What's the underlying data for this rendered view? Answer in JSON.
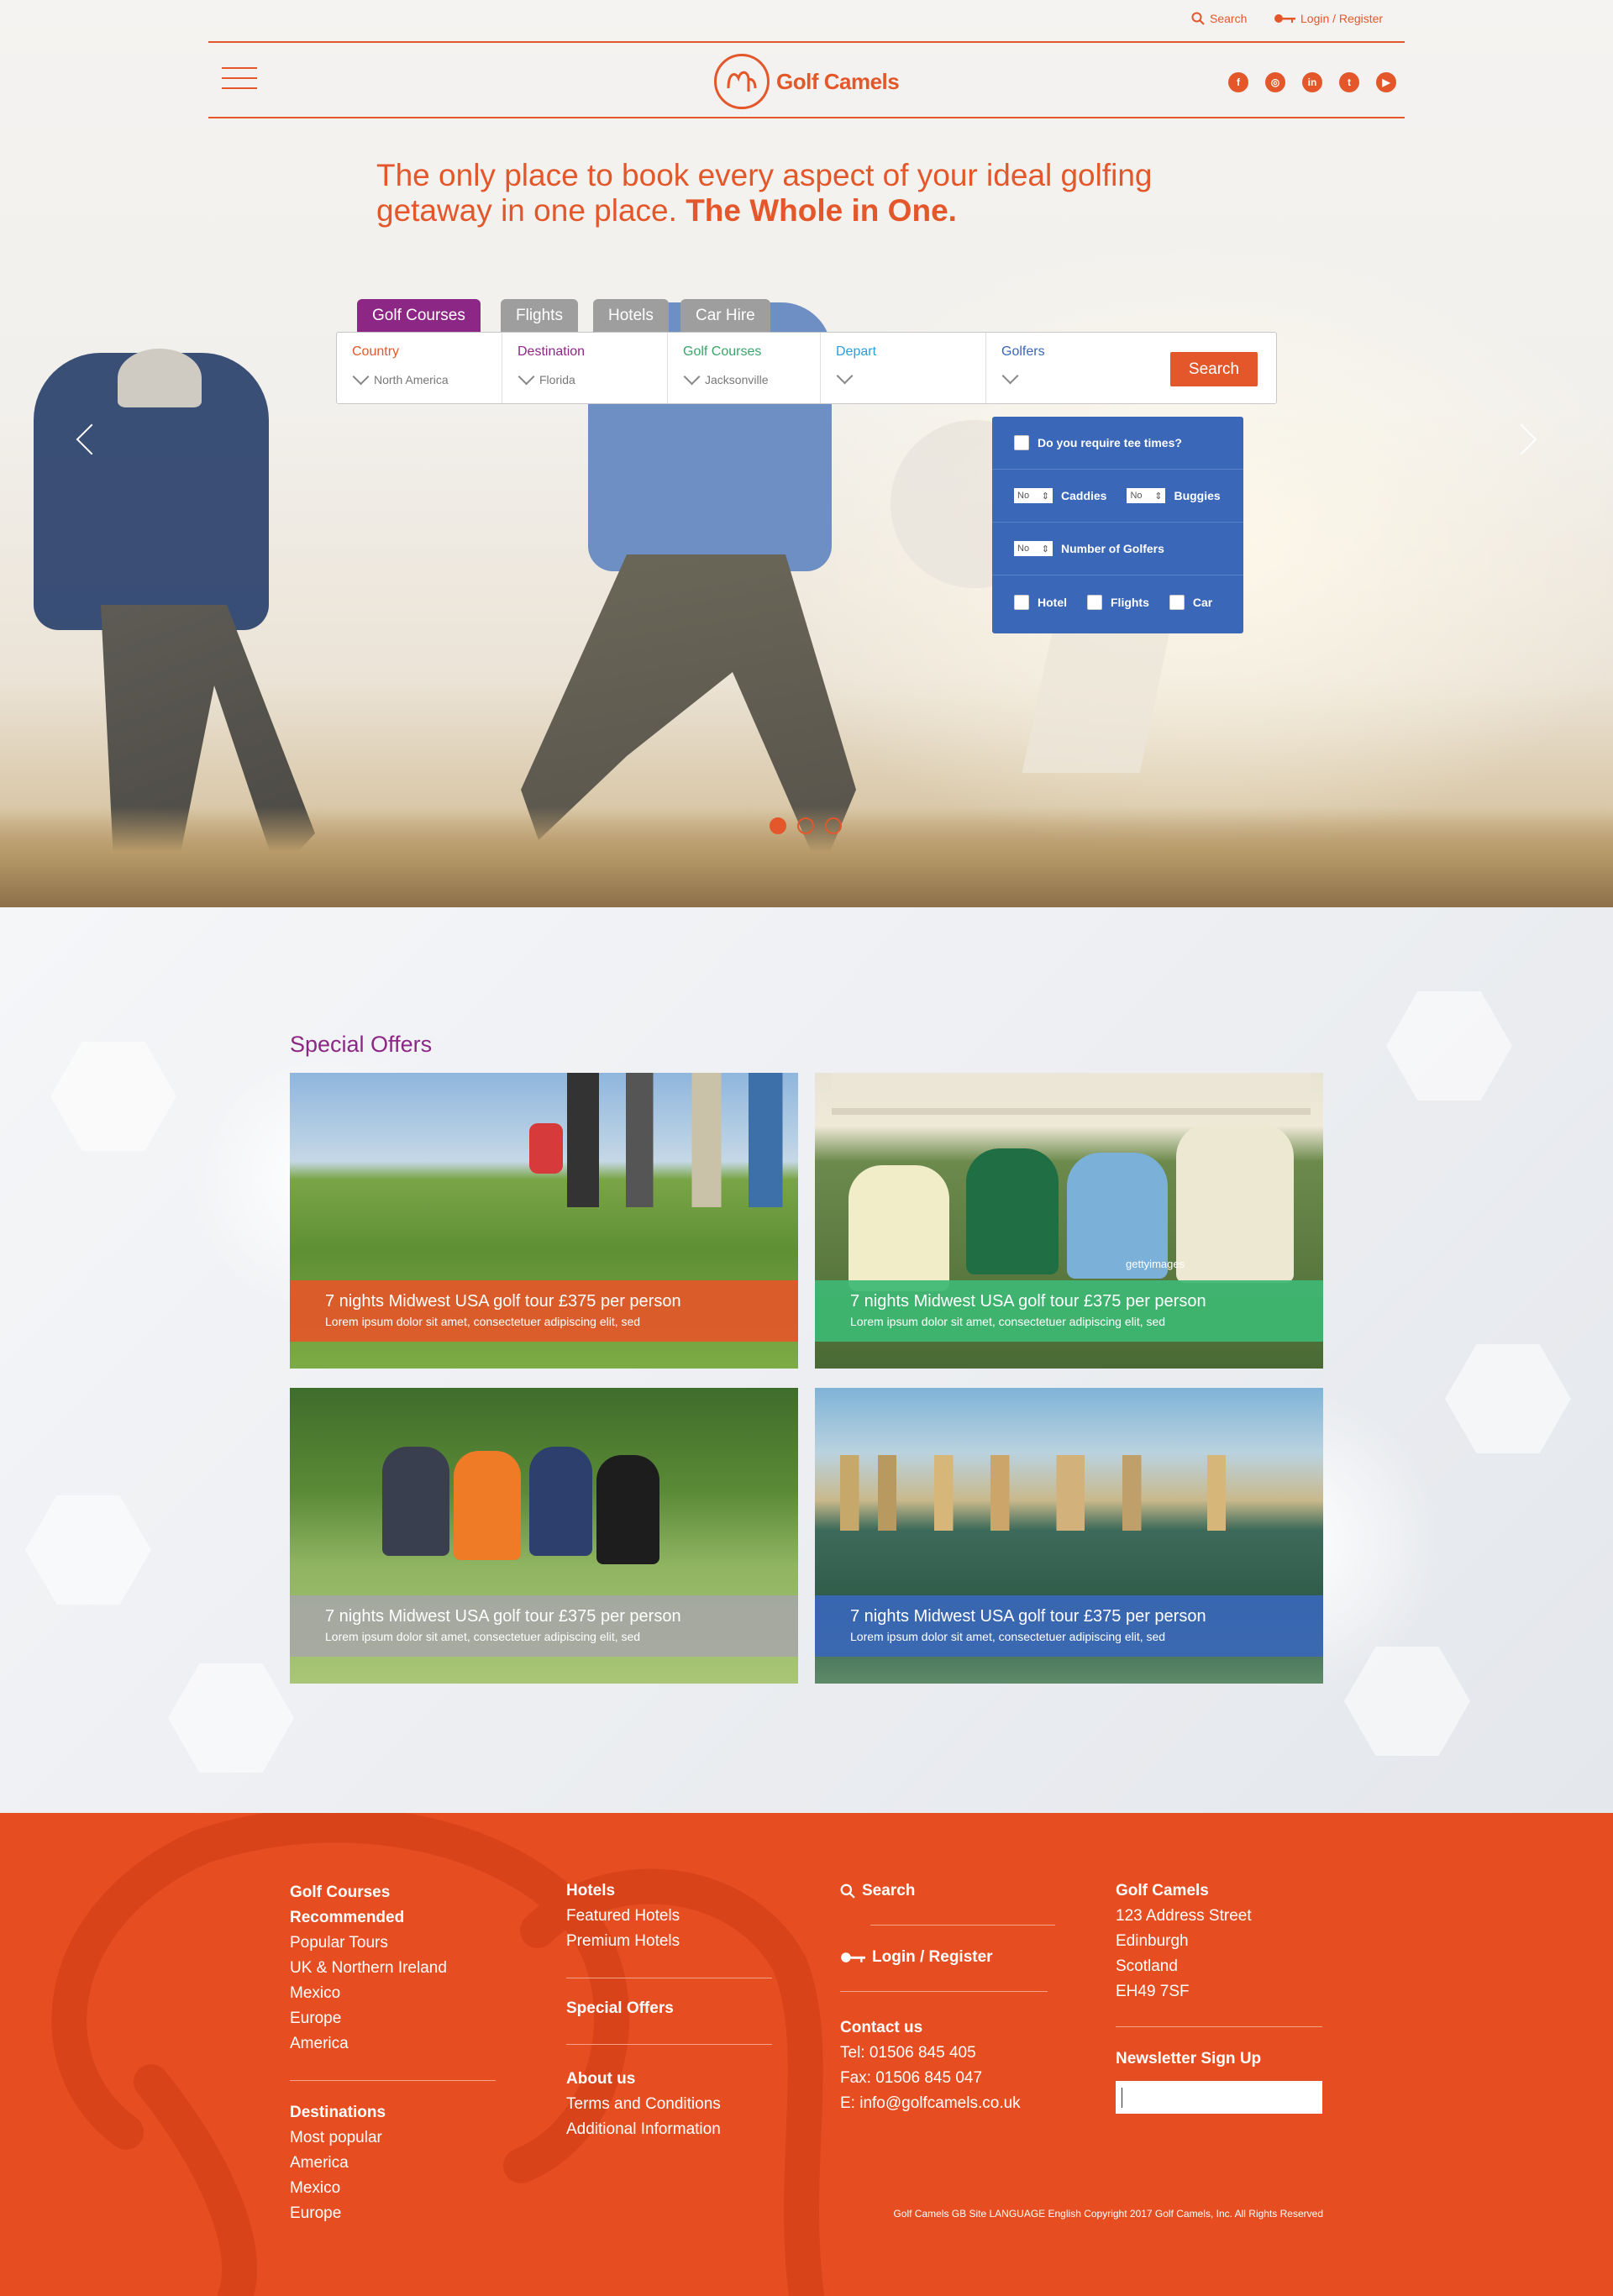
{
  "header": {
    "search_label": "Search",
    "login_label": "Login / Register",
    "brand": "Golf Camels",
    "social": [
      "facebook-icon",
      "instagram-icon",
      "linkedin-icon",
      "twitter-icon",
      "youtube-icon"
    ],
    "accent": "#e3572a"
  },
  "hero": {
    "headline_regular": "The only place to book every aspect of your ideal golfing getaway in one place.",
    "headline_bold": "The Whole in One.",
    "tabs": [
      "Golf Courses",
      "Flights",
      "Hotels",
      "Car Hire"
    ],
    "active_tab": "Golf Courses",
    "fields": [
      {
        "label": "Country",
        "value": "North America",
        "color": "#e3572a"
      },
      {
        "label": "Destination",
        "value": "Florida",
        "color": "#8d2785"
      },
      {
        "label": "Golf Courses",
        "value": "Jacksonville",
        "color": "#3aa56a"
      },
      {
        "label": "Depart",
        "value": "",
        "color": "#2a9fd8"
      },
      {
        "label": "Golfers",
        "value": "",
        "color": "#3a67b8"
      }
    ],
    "search_button": "Search",
    "golfers_panel": {
      "tee_times": "Do you require tee times?",
      "caddies_value": "No",
      "caddies_label": "Caddies",
      "buggies_value": "No",
      "buggies_label": "Buggies",
      "golfers_value": "No",
      "golfers_label": "Number of Golfers",
      "hotel": "Hotel",
      "flights": "Flights",
      "car": "Car"
    },
    "slide_count": 3,
    "active_slide": 1
  },
  "offers": {
    "title": "Special Offers",
    "cards": [
      {
        "title": "7 nights Midwest USA golf tour £375 per person",
        "desc": "Lorem ipsum dolor sit amet, consectetuer adipiscing elit, sed",
        "caption_color": "#e3572a"
      },
      {
        "title": "7 nights Midwest USA golf tour £375 per person",
        "desc": "Lorem ipsum dolor sit amet, consectetuer adipiscing elit, sed",
        "caption_color": "#3db873"
      },
      {
        "title": "7 nights Midwest USA golf tour £375 per person",
        "desc": "Lorem ipsum dolor sit amet, consectetuer adipiscing elit, sed",
        "caption_color": "#a6a6a6"
      },
      {
        "title": "7 nights Midwest USA golf tour £375 per person",
        "desc": "Lorem ipsum dolor sit amet, consectetuer adipiscing elit, sed",
        "caption_color": "#3a67b8"
      }
    ],
    "watermark": "gettyimages"
  },
  "footer": {
    "col1": {
      "heading": "Golf Courses",
      "items": [
        "Recommended",
        "Popular Tours",
        "UK & Northern Ireland",
        "Mexico",
        "Europe",
        "America"
      ],
      "heading2": "Destinations",
      "items2": [
        "Most popular",
        "America",
        "Mexico",
        "Europe"
      ]
    },
    "col2": {
      "heading": "Hotels",
      "items": [
        "Featured Hotels",
        "Premium Hotels"
      ],
      "special": "Special Offers",
      "about": "About us",
      "terms": "Terms and Conditions",
      "additional": "Additional Information"
    },
    "col3": {
      "search": "Search",
      "login": "Login / Register",
      "contact_heading": "Contact us",
      "tel": "Tel: 01506 845 405",
      "fax": "Fax: 01506 845 047",
      "email": "E: info@golfcamels.co.uk"
    },
    "col4": {
      "name": "Golf Camels",
      "addr1": "123 Address Street",
      "addr2": "Edinburgh",
      "addr3": "Scotland",
      "postcode": "EH49 7SF",
      "newsletter": "Newsletter Sign Up"
    },
    "copyright": "Golf Camels GB Site LANGUAGE English Copyright 2017 Golf Camels, Inc. All Rights Reserved"
  }
}
